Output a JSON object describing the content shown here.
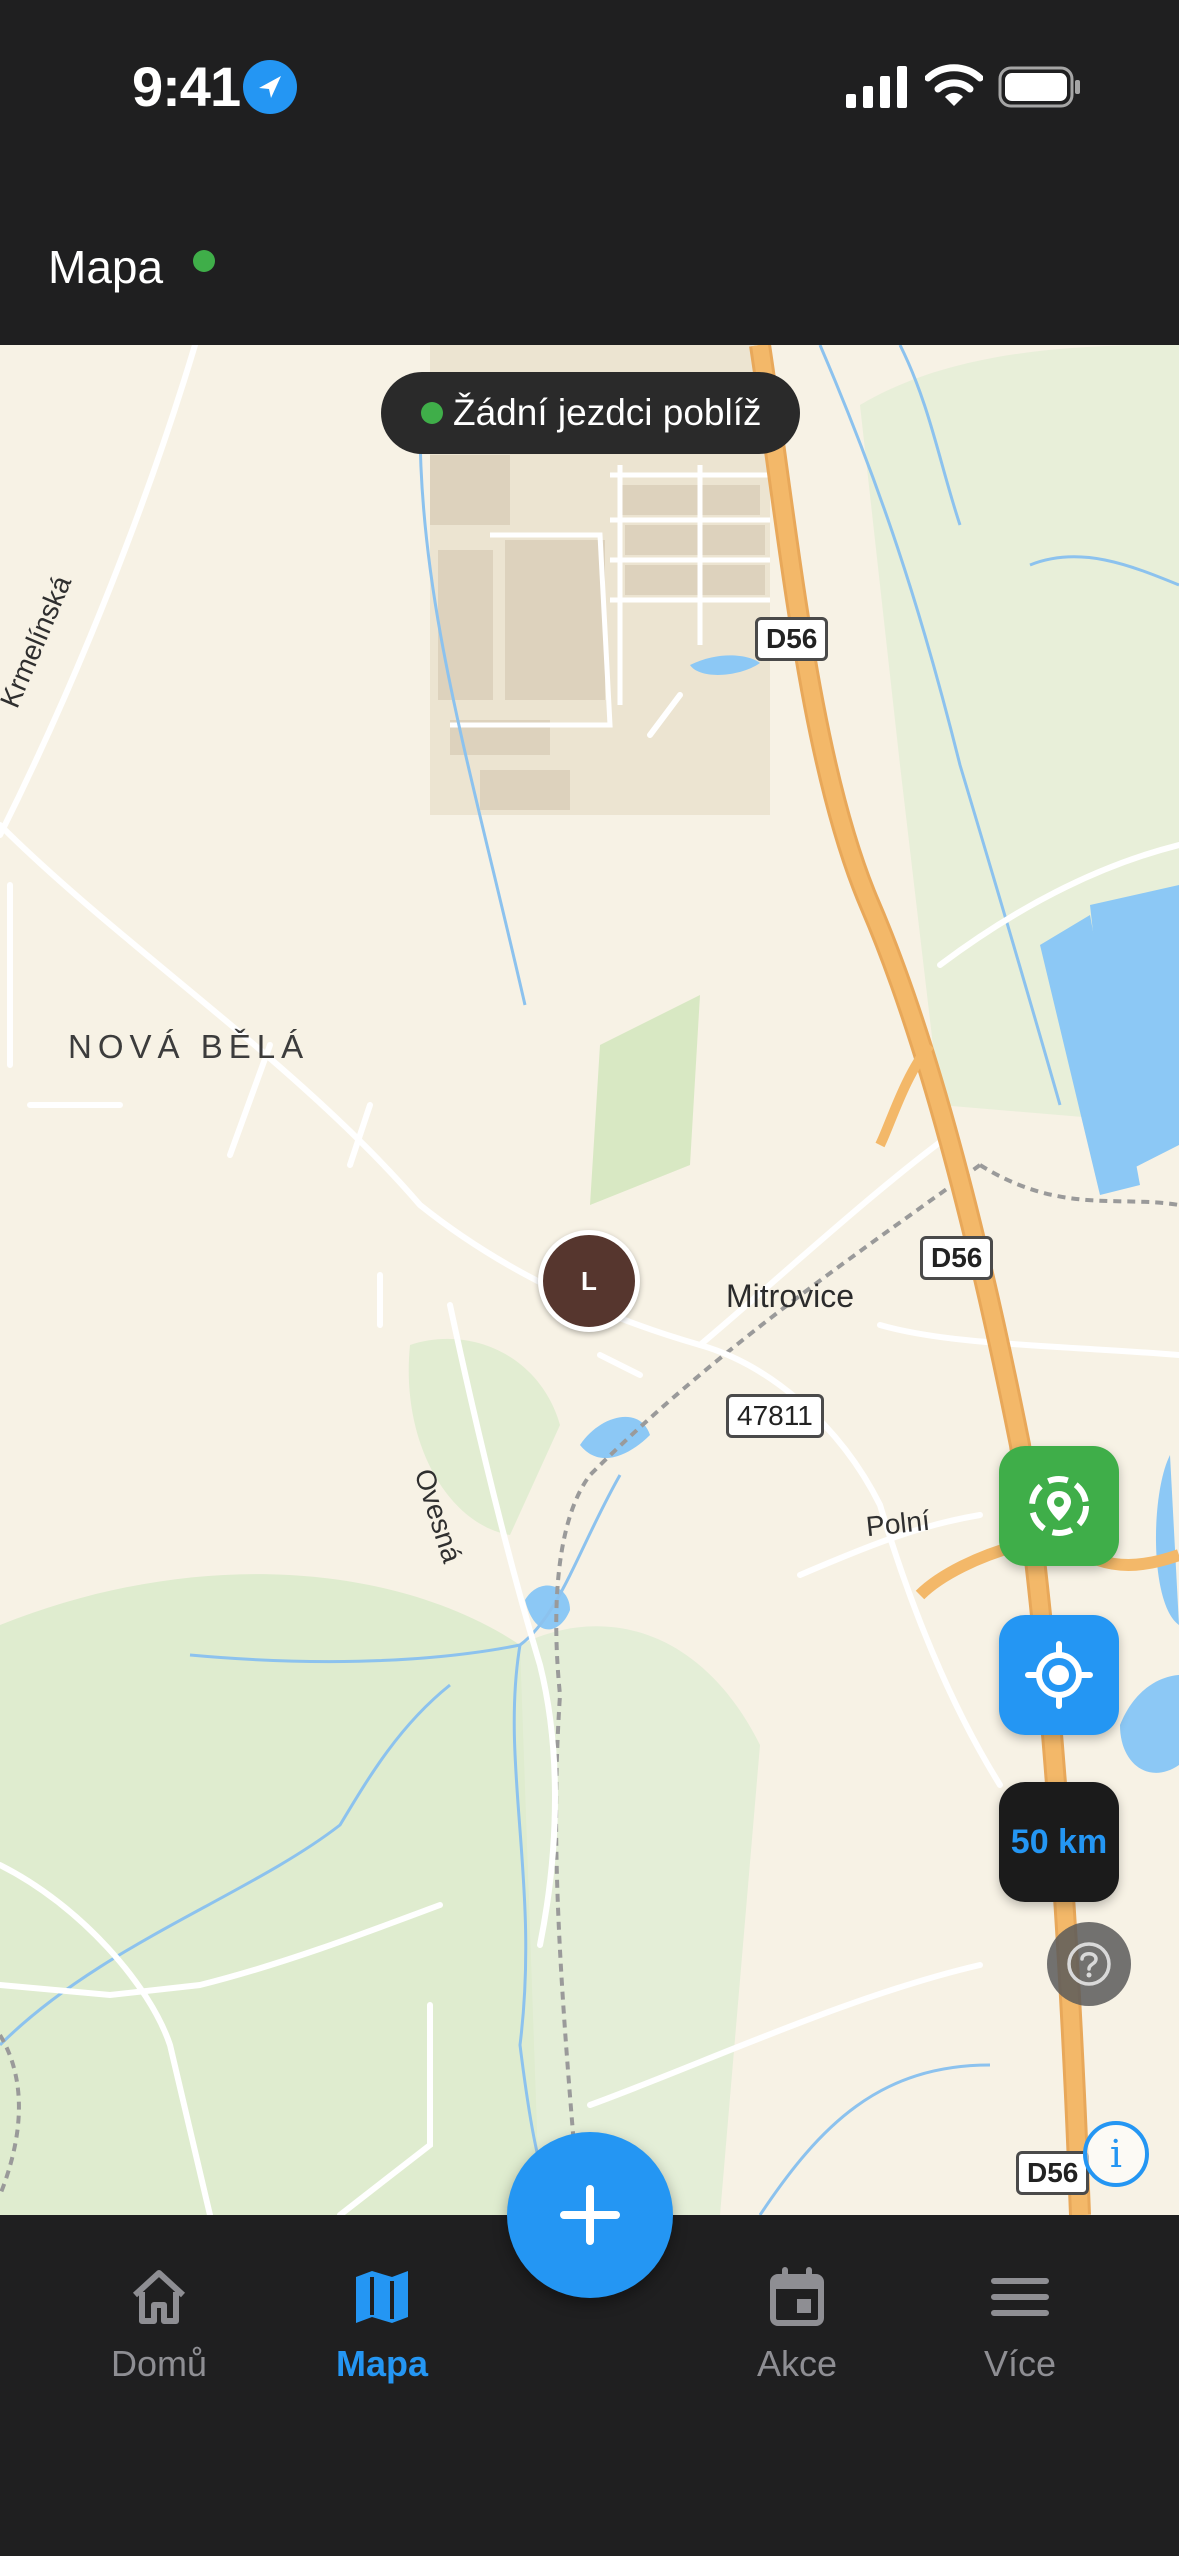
{
  "status_bar": {
    "time": "9:41",
    "icons": [
      "location-arrow-icon",
      "cellular-signal-icon",
      "wifi-icon",
      "battery-icon"
    ]
  },
  "header": {
    "title": "Mapa",
    "status_color": "#3fae49"
  },
  "map": {
    "nearby_status": "Žádní jezdci poblíž",
    "place_label": "NOVÁ BĚLÁ",
    "village_label": "Mitrovice",
    "streets": {
      "krmelinska": "Krmelínská",
      "ovesna": "Ovesná",
      "polni": "Polní"
    },
    "road_shields": [
      "D56",
      "D56",
      "47811",
      "D56"
    ],
    "rider_marker": "L",
    "buttons": {
      "geofence": "geofence-icon",
      "my_location": "crosshair-icon",
      "radius": "50 km",
      "help": "help-icon",
      "info": "i"
    }
  },
  "tabbar": {
    "items": [
      {
        "label": "Domů",
        "icon": "home-icon",
        "active": false
      },
      {
        "label": "Mapa",
        "icon": "map-icon",
        "active": true
      },
      {
        "label": "Akce",
        "icon": "calendar-icon",
        "active": false
      },
      {
        "label": "Více",
        "icon": "menu-icon",
        "active": false
      }
    ],
    "add_icon": "plus-icon"
  },
  "colors": {
    "accent": "#2496f3",
    "success": "#3fae49",
    "background": "#1f1f20",
    "map_land": "#f7f2e5",
    "highway": "#f3b869",
    "water": "#8cc8f5"
  }
}
